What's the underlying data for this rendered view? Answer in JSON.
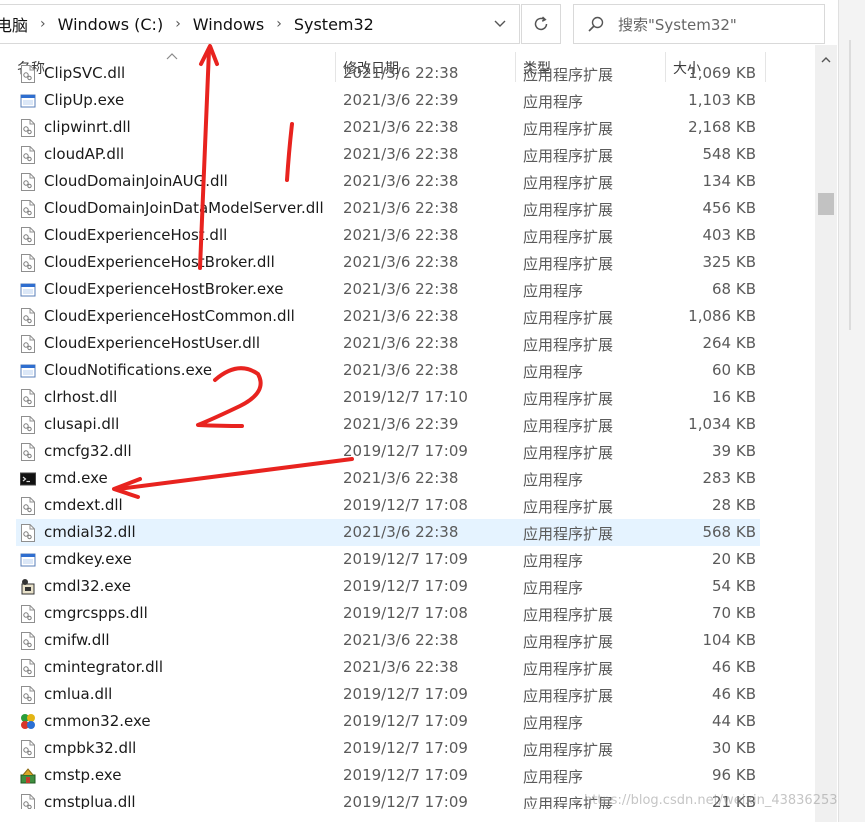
{
  "breadcrumb": {
    "items": [
      "电脑",
      "Windows (C:)",
      "Windows",
      "System32"
    ],
    "separator": "›"
  },
  "search": {
    "placeholder": "搜索\"System32\""
  },
  "columns": {
    "name": "名称",
    "date": "修改日期",
    "type": "类型",
    "size": "大小"
  },
  "files": [
    {
      "name": "ClipSVC.dll",
      "date": "2021/3/6 22:38",
      "type": "应用程序扩展",
      "size": "1,069 KB",
      "icon": "dll-icon"
    },
    {
      "name": "ClipUp.exe",
      "date": "2021/3/6 22:39",
      "type": "应用程序",
      "size": "1,103 KB",
      "icon": "exe-icon"
    },
    {
      "name": "clipwinrt.dll",
      "date": "2021/3/6 22:38",
      "type": "应用程序扩展",
      "size": "2,168 KB",
      "icon": "dll-icon"
    },
    {
      "name": "cloudAP.dll",
      "date": "2021/3/6 22:38",
      "type": "应用程序扩展",
      "size": "548 KB",
      "icon": "dll-icon"
    },
    {
      "name": "CloudDomainJoinAUG.dll",
      "date": "2021/3/6 22:38",
      "type": "应用程序扩展",
      "size": "134 KB",
      "icon": "dll-icon"
    },
    {
      "name": "CloudDomainJoinDataModelServer.dll",
      "date": "2021/3/6 22:38",
      "type": "应用程序扩展",
      "size": "456 KB",
      "icon": "dll-icon"
    },
    {
      "name": "CloudExperienceHost.dll",
      "date": "2021/3/6 22:38",
      "type": "应用程序扩展",
      "size": "403 KB",
      "icon": "dll-icon"
    },
    {
      "name": "CloudExperienceHostBroker.dll",
      "date": "2021/3/6 22:38",
      "type": "应用程序扩展",
      "size": "325 KB",
      "icon": "dll-icon"
    },
    {
      "name": "CloudExperienceHostBroker.exe",
      "date": "2021/3/6 22:38",
      "type": "应用程序",
      "size": "68 KB",
      "icon": "exe-icon"
    },
    {
      "name": "CloudExperienceHostCommon.dll",
      "date": "2021/3/6 22:38",
      "type": "应用程序扩展",
      "size": "1,086 KB",
      "icon": "dll-icon"
    },
    {
      "name": "CloudExperienceHostUser.dll",
      "date": "2021/3/6 22:38",
      "type": "应用程序扩展",
      "size": "264 KB",
      "icon": "dll-icon"
    },
    {
      "name": "CloudNotifications.exe",
      "date": "2021/3/6 22:38",
      "type": "应用程序",
      "size": "60 KB",
      "icon": "exe-icon"
    },
    {
      "name": "clrhost.dll",
      "date": "2019/12/7 17:10",
      "type": "应用程序扩展",
      "size": "16 KB",
      "icon": "dll-icon"
    },
    {
      "name": "clusapi.dll",
      "date": "2021/3/6 22:39",
      "type": "应用程序扩展",
      "size": "1,034 KB",
      "icon": "dll-icon"
    },
    {
      "name": "cmcfg32.dll",
      "date": "2019/12/7 17:09",
      "type": "应用程序扩展",
      "size": "39 KB",
      "icon": "dll-icon"
    },
    {
      "name": "cmd.exe",
      "date": "2021/3/6 22:38",
      "type": "应用程序",
      "size": "283 KB",
      "icon": "cmd-icon"
    },
    {
      "name": "cmdext.dll",
      "date": "2019/12/7 17:08",
      "type": "应用程序扩展",
      "size": "28 KB",
      "icon": "dll-icon"
    },
    {
      "name": "cmdial32.dll",
      "date": "2021/3/6 22:38",
      "type": "应用程序扩展",
      "size": "568 KB",
      "icon": "dll-icon",
      "selected": true
    },
    {
      "name": "cmdkey.exe",
      "date": "2019/12/7 17:09",
      "type": "应用程序",
      "size": "20 KB",
      "icon": "exe-icon"
    },
    {
      "name": "cmdl32.exe",
      "date": "2019/12/7 17:09",
      "type": "应用程序",
      "size": "54 KB",
      "icon": "cmdl-icon"
    },
    {
      "name": "cmgrcspps.dll",
      "date": "2019/12/7 17:08",
      "type": "应用程序扩展",
      "size": "70 KB",
      "icon": "dll-icon"
    },
    {
      "name": "cmifw.dll",
      "date": "2021/3/6 22:38",
      "type": "应用程序扩展",
      "size": "104 KB",
      "icon": "dll-icon"
    },
    {
      "name": "cmintegrator.dll",
      "date": "2021/3/6 22:38",
      "type": "应用程序扩展",
      "size": "46 KB",
      "icon": "dll-icon"
    },
    {
      "name": "cmlua.dll",
      "date": "2019/12/7 17:09",
      "type": "应用程序扩展",
      "size": "46 KB",
      "icon": "dll-icon"
    },
    {
      "name": "cmmon32.exe",
      "date": "2019/12/7 17:09",
      "type": "应用程序",
      "size": "44 KB",
      "icon": "cmmon-icon"
    },
    {
      "name": "cmpbk32.dll",
      "date": "2019/12/7 17:09",
      "type": "应用程序扩展",
      "size": "30 KB",
      "icon": "dll-icon"
    },
    {
      "name": "cmstp.exe",
      "date": "2019/12/7 17:09",
      "type": "应用程序",
      "size": "96 KB",
      "icon": "cmstp-icon"
    },
    {
      "name": "cmstplua.dll",
      "date": "2019/12/7 17:09",
      "type": "应用程序扩展",
      "size": "21 KB",
      "icon": "dll-icon"
    }
  ],
  "annotations": {
    "label_1": "1",
    "label_2": "2",
    "color": "#e8231f"
  },
  "watermark": "https://blog.csdn.net/weixin_43836253"
}
